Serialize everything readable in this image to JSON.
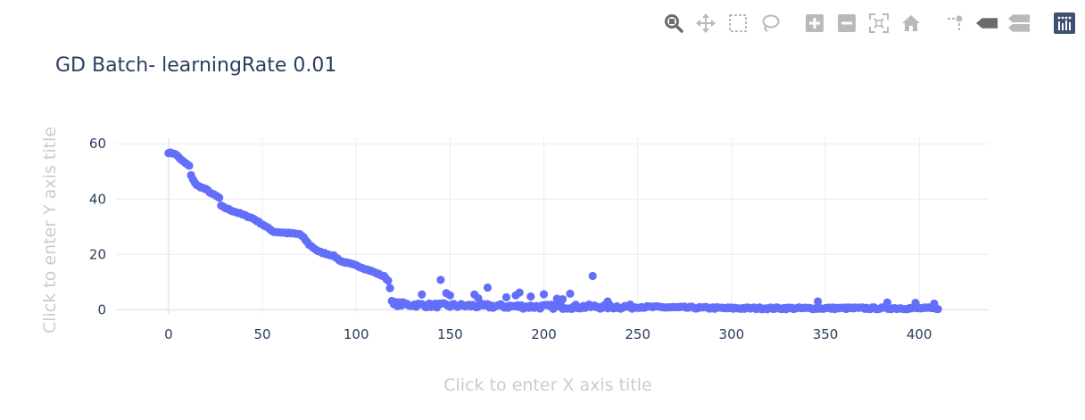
{
  "modebar": {
    "buttons": [
      {
        "name": "zoom-icon",
        "active": true
      },
      {
        "name": "pan-icon"
      },
      {
        "name": "box-select-icon"
      },
      {
        "name": "lasso-select-icon"
      },
      {
        "name": "zoom-in-icon"
      },
      {
        "name": "zoom-out-icon"
      },
      {
        "name": "autoscale-icon"
      },
      {
        "name": "reset-axes-icon"
      },
      {
        "name": "spike-lines-icon"
      },
      {
        "name": "hover-closest-icon"
      },
      {
        "name": "hover-compare-icon"
      },
      {
        "name": "plotly-logo-icon"
      }
    ]
  },
  "colors": {
    "marker": "#636efa",
    "grid": "#e9ecf3",
    "zeroline": "#e9ecf3",
    "text": "#2a3f5f",
    "placeholder": "#c8ccd3",
    "icon": "#b9b9b9",
    "icon_active": "#6b6b6b",
    "logo": "#3f4f75"
  },
  "chart_data": {
    "type": "scatter",
    "title": "GD Batch- learningRate 0.01",
    "xlabel": "Click to enter X axis title",
    "ylabel": "Click to enter Y axis title",
    "xlim": [
      -28,
      437
    ],
    "ylim": [
      -1.5,
      62
    ],
    "xticks": [
      0,
      50,
      100,
      150,
      200,
      250,
      300,
      350,
      400
    ],
    "yticks": [
      0,
      20,
      40,
      60
    ],
    "grid": true,
    "anchors": [
      [
        0,
        56.8
      ],
      [
        3,
        56.5
      ],
      [
        5,
        55.5
      ],
      [
        7,
        54
      ],
      [
        9,
        53
      ],
      [
        11,
        52
      ],
      [
        12,
        48.5
      ],
      [
        14,
        46
      ],
      [
        15,
        45
      ],
      [
        20,
        43.5
      ],
      [
        23,
        42
      ],
      [
        27,
        40.5
      ],
      [
        28,
        37.5
      ],
      [
        33,
        36
      ],
      [
        38,
        34.8
      ],
      [
        45,
        33
      ],
      [
        52,
        30
      ],
      [
        56,
        28.2
      ],
      [
        70,
        27.3
      ],
      [
        72,
        26
      ],
      [
        75,
        23.5
      ],
      [
        80,
        21
      ],
      [
        88,
        19.5
      ],
      [
        92,
        17.5
      ],
      [
        100,
        16
      ],
      [
        108,
        14
      ],
      [
        115,
        12
      ],
      [
        117,
        10.5
      ],
      [
        118,
        8
      ],
      [
        119,
        3
      ],
      [
        120,
        2
      ],
      [
        140,
        1.5
      ],
      [
        200,
        1
      ],
      [
        250,
        1
      ],
      [
        300,
        0.5
      ],
      [
        410,
        0.5
      ]
    ],
    "noise_after_x": 120,
    "outliers": [
      {
        "x": 135,
        "y": 5.5
      },
      {
        "x": 145,
        "y": 10.8
      },
      {
        "x": 148,
        "y": 6
      },
      {
        "x": 150,
        "y": 5.2
      },
      {
        "x": 163,
        "y": 5.5
      },
      {
        "x": 165,
        "y": 4.2
      },
      {
        "x": 170,
        "y": 8
      },
      {
        "x": 180,
        "y": 4.5
      },
      {
        "x": 185,
        "y": 5.2
      },
      {
        "x": 187,
        "y": 6.2
      },
      {
        "x": 193,
        "y": 4.8
      },
      {
        "x": 200,
        "y": 5.6
      },
      {
        "x": 207,
        "y": 4
      },
      {
        "x": 210,
        "y": 3.8
      },
      {
        "x": 214,
        "y": 5.8
      },
      {
        "x": 226,
        "y": 12.2
      },
      {
        "x": 234,
        "y": 3
      },
      {
        "x": 346,
        "y": 3
      },
      {
        "x": 383,
        "y": 2.6
      },
      {
        "x": 398,
        "y": 2.5
      },
      {
        "x": 408,
        "y": 2.2
      }
    ]
  }
}
